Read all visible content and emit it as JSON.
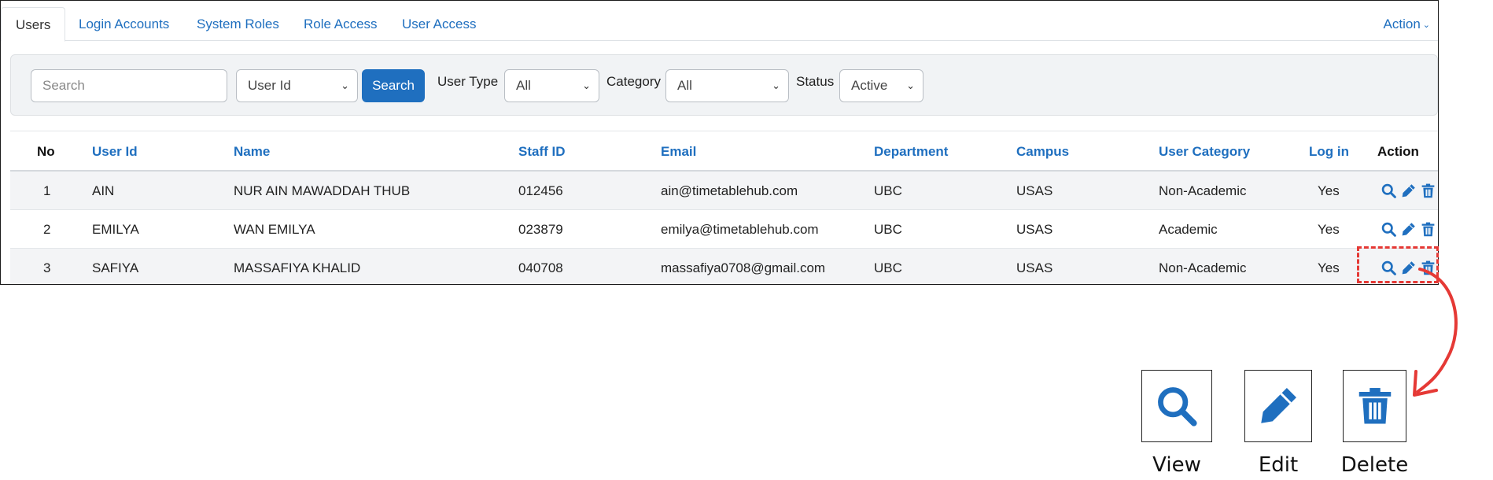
{
  "tabs": [
    {
      "label": "Users",
      "active": true
    },
    {
      "label": "Login Accounts",
      "active": false
    },
    {
      "label": "System Roles",
      "active": false
    },
    {
      "label": "Role Access",
      "active": false
    },
    {
      "label": "User Access",
      "active": false
    }
  ],
  "action_menu": {
    "label": "Action"
  },
  "filters": {
    "search_placeholder": "Search",
    "field_select": "User Id",
    "search_button": "Search",
    "user_type_label": "User Type",
    "user_type_value": "All",
    "category_label": "Category",
    "category_value": "All",
    "status_label": "Status",
    "status_value": "Active"
  },
  "table": {
    "headers": {
      "no": "No",
      "user_id": "User Id",
      "name": "Name",
      "staff_id": "Staff ID",
      "email": "Email",
      "department": "Department",
      "campus": "Campus",
      "user_category": "User Category",
      "log_in": "Log in",
      "action": "Action"
    },
    "rows": [
      {
        "no": "1",
        "user_id": "AIN",
        "name": "NUR AIN MAWADDAH THUB",
        "staff_id": "012456",
        "email": "ain@timetablehub.com",
        "department": "UBC",
        "campus": "USAS",
        "user_category": "Non-Academic",
        "log_in": "Yes"
      },
      {
        "no": "2",
        "user_id": "EMILYA",
        "name": "WAN EMILYA",
        "staff_id": "023879",
        "email": "emilya@timetablehub.com",
        "department": "UBC",
        "campus": "USAS",
        "user_category": "Academic",
        "log_in": "Yes"
      },
      {
        "no": "3",
        "user_id": "SAFIYA",
        "name": "MASSAFIYA KHALID",
        "staff_id": "040708",
        "email": "massafiya0708@gmail.com",
        "department": "UBC",
        "campus": "USAS",
        "user_category": "Non-Academic",
        "log_in": "Yes"
      }
    ]
  },
  "legend": {
    "view": "View",
    "edit": "Edit",
    "delete": "Delete"
  },
  "colors": {
    "accent": "#1f6fbf",
    "highlight": "#e53935"
  },
  "icons": {
    "view": "search-icon",
    "edit": "pencil-icon",
    "delete": "trash-icon"
  }
}
